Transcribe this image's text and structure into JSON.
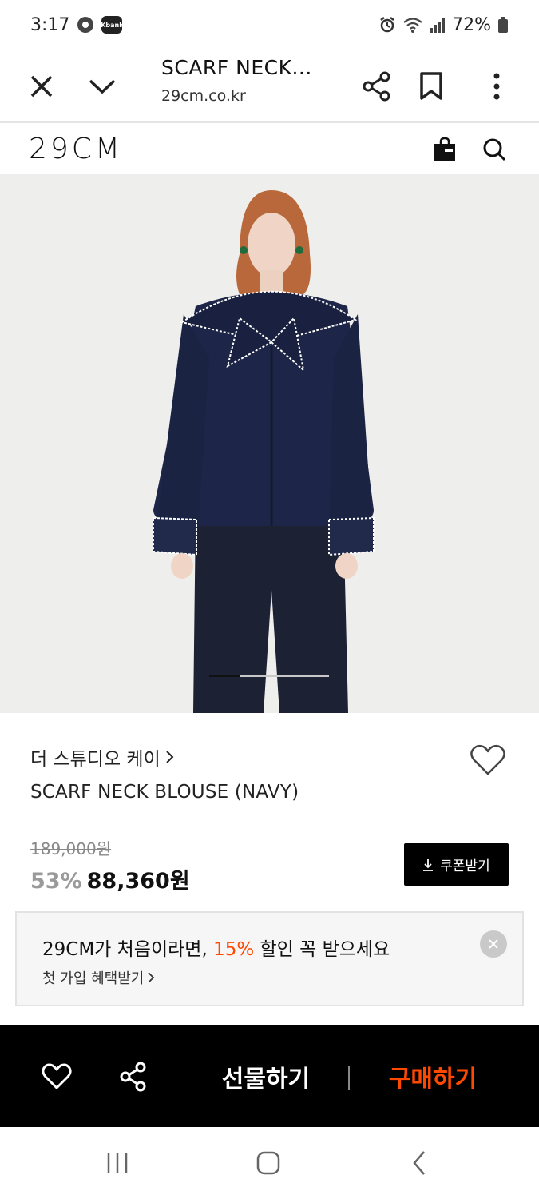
{
  "status_bar": {
    "time": "3:17",
    "kbank_label": "Kbank",
    "battery": "72%"
  },
  "browser": {
    "title": "SCARF NECK...",
    "url": "29cm.co.kr"
  },
  "site": {
    "logo": "29CM"
  },
  "carousel": {
    "active_fraction": 0.25
  },
  "product": {
    "brand": "더 스튜디오 케이",
    "name": "SCARF NECK BLOUSE (NAVY)",
    "original_price": "189,000원",
    "discount": "53%",
    "sale_price": "88,360원",
    "coupon_label": "쿠폰받기"
  },
  "promo": {
    "text_before": "29CM가 처음이라면, ",
    "highlight": "15%",
    "text_after": " 할인 꼭 받으세요",
    "sub": "첫 가입 혜택받기",
    "highlight_color": "#ff4800"
  },
  "actions": {
    "gift": "선물하기",
    "buy": "구매하기",
    "buy_color": "#ff4800"
  }
}
